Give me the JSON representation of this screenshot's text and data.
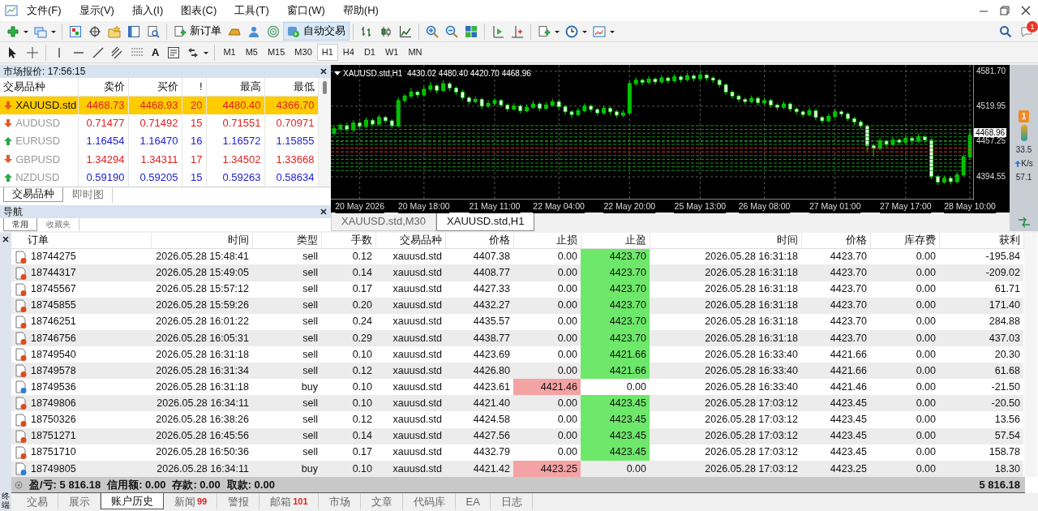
{
  "menu": [
    "文件(F)",
    "显示(V)",
    "插入(I)",
    "图表(C)",
    "工具(T)",
    "窗口(W)",
    "帮助(H)"
  ],
  "toolbar": {
    "new_order": "新订单",
    "auto_trading": "自动交易",
    "text_tool": "A",
    "notification_count": "1",
    "timeframes": [
      {
        "label": "M1",
        "selected": false
      },
      {
        "label": "M5",
        "selected": false
      },
      {
        "label": "M15",
        "selected": false
      },
      {
        "label": "M30",
        "selected": false
      },
      {
        "label": "H1",
        "selected": true
      },
      {
        "label": "H4",
        "selected": false
      },
      {
        "label": "D1",
        "selected": false
      },
      {
        "label": "W1",
        "selected": false
      },
      {
        "label": "MN",
        "selected": false
      }
    ]
  },
  "market_watch": {
    "title": "市场报价: 17:56:15",
    "columns": [
      "交易品种",
      "卖价",
      "买价",
      "!",
      "最高",
      "最低"
    ],
    "rows": [
      {
        "symbol": "XAUUSD.std",
        "bid": "4468.73",
        "ask": "4468.93",
        "spread": "20",
        "high": "4480.40",
        "low": "4366.70",
        "rising": false,
        "selected": true
      },
      {
        "symbol": "AUDUSD",
        "bid": "0.71477",
        "ask": "0.71492",
        "spread": "15",
        "high": "0.71551",
        "low": "0.70971",
        "rising": false,
        "selected": false
      },
      {
        "symbol": "EURUSD",
        "bid": "1.16454",
        "ask": "1.16470",
        "spread": "16",
        "high": "1.16572",
        "low": "1.15855",
        "rising": true,
        "selected": false
      },
      {
        "symbol": "GBPUSD",
        "bid": "1.34294",
        "ask": "1.34311",
        "spread": "17",
        "high": "1.34502",
        "low": "1.33668",
        "rising": false,
        "selected": false
      },
      {
        "symbol": "NZDUSD",
        "bid": "0.59190",
        "ask": "0.59205",
        "spread": "15",
        "high": "0.59263",
        "low": "0.58634",
        "rising": true,
        "selected": false
      }
    ],
    "tabs": [
      {
        "label": "交易品种",
        "selected": true
      },
      {
        "label": "即时图",
        "selected": false
      }
    ]
  },
  "navigator": {
    "title": "导航",
    "tabs": [
      {
        "label": "常用",
        "selected": true
      },
      {
        "label": "收藏夹",
        "selected": false
      }
    ]
  },
  "chart": {
    "title": "XAUUSD.std,H1  4430.02 4480.40 4420.70 4468.96",
    "current_price": "4468.96",
    "chart_data": {
      "type": "candlestick",
      "ylim": [
        4355.7,
        4593.2
      ],
      "grid": true,
      "categories": [
        null,
        null,
        null,
        null,
        "20 May 2026",
        null,
        null,
        null,
        null,
        null,
        null,
        null,
        null,
        null,
        "20 May 18:00",
        null,
        null,
        null,
        null,
        null,
        null,
        null,
        null,
        null,
        null,
        "21 May 11:00",
        null,
        null,
        null,
        null,
        null,
        null,
        null,
        null,
        null,
        "22 May 04:00",
        null,
        null,
        null,
        null,
        null,
        null,
        null,
        null,
        null,
        null,
        "22 May 20:00",
        null,
        null,
        null,
        null,
        null,
        null,
        null,
        null,
        null,
        null,
        "25 May 13:00",
        null,
        null,
        null,
        null,
        null,
        null,
        null,
        null,
        null,
        "26 May 08:00",
        null,
        null,
        null,
        null,
        null,
        null,
        null,
        null,
        null,
        null,
        "27 May 01:00",
        null,
        null,
        null,
        null,
        null,
        null,
        null,
        null,
        null,
        null,
        "27 May 17:00",
        null,
        null,
        null,
        null,
        null,
        null,
        null,
        null,
        null,
        "28 May 10:00"
      ],
      "yticks": [
        {
          "value": 4581.7,
          "label": "4581.70"
        },
        {
          "value": 4519.95,
          "label": "4519.95"
        },
        {
          "value": 4457.25,
          "label": "4457.25"
        },
        {
          "value": 4394.55,
          "label": "4394.55"
        }
      ],
      "ohlc": [
        [
          4472,
          4485,
          4468,
          4480
        ],
        [
          4480,
          4489,
          4476,
          4486
        ],
        [
          4486,
          4491,
          4475,
          4478
        ],
        [
          4478,
          4495,
          4474,
          4490
        ],
        [
          4490,
          4493,
          4480,
          4484
        ],
        [
          4484,
          4500,
          4481,
          4495
        ],
        [
          4495,
          4498,
          4484,
          4488
        ],
        [
          4488,
          4505,
          4485,
          4500
        ],
        [
          4500,
          4503,
          4490,
          4494
        ],
        [
          4494,
          4497,
          4481,
          4485
        ],
        [
          4485,
          4535,
          4482,
          4530
        ],
        [
          4530,
          4541,
          4526,
          4538
        ],
        [
          4538,
          4552,
          4534,
          4545
        ],
        [
          4545,
          4548,
          4535,
          4540
        ],
        [
          4540,
          4555,
          4537,
          4550
        ],
        [
          4550,
          4563,
          4546,
          4556
        ],
        [
          4556,
          4559,
          4543,
          4548
        ],
        [
          4548,
          4566,
          4545,
          4560
        ],
        [
          4560,
          4563,
          4547,
          4552
        ],
        [
          4552,
          4555,
          4540,
          4545
        ],
        [
          4545,
          4549,
          4530,
          4535
        ],
        [
          4535,
          4538,
          4523,
          4528
        ],
        [
          4528,
          4537,
          4525,
          4532
        ],
        [
          4532,
          4535,
          4515,
          4520
        ],
        [
          4520,
          4530,
          4517,
          4525
        ],
        [
          4525,
          4534,
          4521,
          4530
        ],
        [
          4530,
          4533,
          4518,
          4522
        ],
        [
          4522,
          4525,
          4510,
          4515
        ],
        [
          4515,
          4525,
          4512,
          4520
        ],
        [
          4520,
          4523,
          4507,
          4512
        ],
        [
          4512,
          4523,
          4509,
          4518
        ],
        [
          4518,
          4529,
          4515,
          4524
        ],
        [
          4524,
          4527,
          4511,
          4516
        ],
        [
          4516,
          4527,
          4513,
          4522
        ],
        [
          4522,
          4533,
          4519,
          4528
        ],
        [
          4528,
          4531,
          4514,
          4519
        ],
        [
          4519,
          4522,
          4505,
          4510
        ],
        [
          4510,
          4513,
          4499,
          4505
        ],
        [
          4505,
          4517,
          4502,
          4512
        ],
        [
          4512,
          4525,
          4509,
          4520
        ],
        [
          4520,
          4523,
          4509,
          4514
        ],
        [
          4514,
          4517,
          4503,
          4508
        ],
        [
          4508,
          4521,
          4505,
          4516
        ],
        [
          4516,
          4519,
          4505,
          4510
        ],
        [
          4510,
          4513,
          4499,
          4504
        ],
        [
          4504,
          4513,
          4500,
          4508
        ],
        [
          4508,
          4565,
          4505,
          4560
        ],
        [
          4560,
          4571,
          4556,
          4566
        ],
        [
          4566,
          4569,
          4557,
          4562
        ],
        [
          4562,
          4573,
          4559,
          4568
        ],
        [
          4568,
          4571,
          4558,
          4563
        ],
        [
          4563,
          4575,
          4560,
          4570
        ],
        [
          4570,
          4573,
          4560,
          4565
        ],
        [
          4565,
          4577,
          4562,
          4572
        ],
        [
          4572,
          4575,
          4562,
          4567
        ],
        [
          4567,
          4579,
          4564,
          4574
        ],
        [
          4574,
          4577,
          4564,
          4569
        ],
        [
          4569,
          4580,
          4566,
          4575
        ],
        [
          4575,
          4578,
          4565,
          4570
        ],
        [
          4570,
          4573,
          4561,
          4566
        ],
        [
          4566,
          4569,
          4553,
          4558
        ],
        [
          4558,
          4561,
          4540,
          4545
        ],
        [
          4545,
          4548,
          4533,
          4538
        ],
        [
          4538,
          4541,
          4527,
          4532
        ],
        [
          4532,
          4535,
          4523,
          4528
        ],
        [
          4528,
          4539,
          4525,
          4534
        ],
        [
          4534,
          4537,
          4521,
          4526
        ],
        [
          4526,
          4535,
          4523,
          4530
        ],
        [
          4530,
          4533,
          4517,
          4522
        ],
        [
          4522,
          4525,
          4513,
          4518
        ],
        [
          4518,
          4529,
          4515,
          4524
        ],
        [
          4524,
          4527,
          4510,
          4515
        ],
        [
          4515,
          4518,
          4505,
          4510
        ],
        [
          4510,
          4513,
          4500,
          4505
        ],
        [
          4505,
          4517,
          4502,
          4512
        ],
        [
          4512,
          4515,
          4495,
          4500
        ],
        [
          4500,
          4503,
          4489,
          4494
        ],
        [
          4494,
          4507,
          4491,
          4502
        ],
        [
          4502,
          4515,
          4499,
          4510
        ],
        [
          4510,
          4513,
          4501,
          4506
        ],
        [
          4506,
          4509,
          4493,
          4498
        ],
        [
          4498,
          4501,
          4487,
          4492
        ],
        [
          4492,
          4495,
          4480,
          4485
        ],
        [
          4485,
          4488,
          4440,
          4450
        ],
        [
          4450,
          4453,
          4430,
          4445
        ],
        [
          4445,
          4463,
          4442,
          4458
        ],
        [
          4458,
          4461,
          4447,
          4452
        ],
        [
          4452,
          4465,
          4449,
          4460
        ],
        [
          4460,
          4463,
          4451,
          4456
        ],
        [
          4456,
          4468,
          4453,
          4463
        ],
        [
          4463,
          4466,
          4453,
          4458
        ],
        [
          4458,
          4471,
          4455,
          4466
        ],
        [
          4466,
          4469,
          4455,
          4460
        ],
        [
          4460,
          4463,
          4390,
          4395
        ],
        [
          4395,
          4398,
          4380,
          4385
        ],
        [
          4385,
          4397,
          4382,
          4392
        ],
        [
          4392,
          4395,
          4381,
          4386
        ],
        [
          4386,
          4403,
          4383,
          4398
        ],
        [
          4398,
          4435,
          4395,
          4430
        ],
        [
          4430,
          4478,
          4427,
          4468
        ]
      ]
    },
    "tabs": [
      {
        "label": "XAUUSD.std,M30",
        "selected": false
      },
      {
        "label": "XAUUSD.std,H1",
        "selected": true
      }
    ]
  },
  "side_panel": {
    "alert_count": "1",
    "readings": [
      "33.5",
      "K/s",
      "57.1"
    ]
  },
  "terminal": {
    "side_label": "终端",
    "columns": [
      "订单",
      "时间",
      "类型",
      "手数",
      "交易品种",
      "价格",
      "止损",
      "止盈",
      "时间",
      "价格",
      "库存费",
      "获利"
    ],
    "rows": [
      {
        "order": "18744275",
        "open_time": "2026.05.28 15:48:41",
        "type": "sell",
        "lots": "0.12",
        "symbol": "xauusd.std",
        "open_price": "4407.38",
        "sl": "0.00",
        "tp": "4423.70",
        "close_time": "2026.05.28 16:31:18",
        "close_price": "4423.70",
        "swap": "0.00",
        "profit": "-195.84",
        "kind": "sell",
        "sl_hit": false,
        "tp_hit": true
      },
      {
        "order": "18744317",
        "open_time": "2026.05.28 15:49:05",
        "type": "sell",
        "lots": "0.14",
        "symbol": "xauusd.std",
        "open_price": "4408.77",
        "sl": "0.00",
        "tp": "4423.70",
        "close_time": "2026.05.28 16:31:18",
        "close_price": "4423.70",
        "swap": "0.00",
        "profit": "-209.02",
        "kind": "sell",
        "sl_hit": false,
        "tp_hit": true
      },
      {
        "order": "18745567",
        "open_time": "2026.05.28 15:57:12",
        "type": "sell",
        "lots": "0.17",
        "symbol": "xauusd.std",
        "open_price": "4427.33",
        "sl": "0.00",
        "tp": "4423.70",
        "close_time": "2026.05.28 16:31:18",
        "close_price": "4423.70",
        "swap": "0.00",
        "profit": "61.71",
        "kind": "sell",
        "sl_hit": false,
        "tp_hit": true
      },
      {
        "order": "18745855",
        "open_time": "2026.05.28 15:59:26",
        "type": "sell",
        "lots": "0.20",
        "symbol": "xauusd.std",
        "open_price": "4432.27",
        "sl": "0.00",
        "tp": "4423.70",
        "close_time": "2026.05.28 16:31:18",
        "close_price": "4423.70",
        "swap": "0.00",
        "profit": "171.40",
        "kind": "sell",
        "sl_hit": false,
        "tp_hit": true
      },
      {
        "order": "18746251",
        "open_time": "2026.05.28 16:01:22",
        "type": "sell",
        "lots": "0.24",
        "symbol": "xauusd.std",
        "open_price": "4435.57",
        "sl": "0.00",
        "tp": "4423.70",
        "close_time": "2026.05.28 16:31:18",
        "close_price": "4423.70",
        "swap": "0.00",
        "profit": "284.88",
        "kind": "sell",
        "sl_hit": false,
        "tp_hit": true
      },
      {
        "order": "18746756",
        "open_time": "2026.05.28 16:05:31",
        "type": "sell",
        "lots": "0.29",
        "symbol": "xauusd.std",
        "open_price": "4438.77",
        "sl": "0.00",
        "tp": "4423.70",
        "close_time": "2026.05.28 16:31:18",
        "close_price": "4423.70",
        "swap": "0.00",
        "profit": "437.03",
        "kind": "sell",
        "sl_hit": false,
        "tp_hit": true
      },
      {
        "order": "18749540",
        "open_time": "2026.05.28 16:31:18",
        "type": "sell",
        "lots": "0.10",
        "symbol": "xauusd.std",
        "open_price": "4423.69",
        "sl": "0.00",
        "tp": "4421.66",
        "close_time": "2026.05.28 16:33:40",
        "close_price": "4421.66",
        "swap": "0.00",
        "profit": "20.30",
        "kind": "sell",
        "sl_hit": false,
        "tp_hit": true
      },
      {
        "order": "18749578",
        "open_time": "2026.05.28 16:31:34",
        "type": "sell",
        "lots": "0.12",
        "symbol": "xauusd.std",
        "open_price": "4426.80",
        "sl": "0.00",
        "tp": "4421.66",
        "close_time": "2026.05.28 16:33:40",
        "close_price": "4421.66",
        "swap": "0.00",
        "profit": "61.68",
        "kind": "sell",
        "sl_hit": false,
        "tp_hit": true
      },
      {
        "order": "18749536",
        "open_time": "2026.05.28 16:31:18",
        "type": "buy",
        "lots": "0.10",
        "symbol": "xauusd.std",
        "open_price": "4423.61",
        "sl": "4421.46",
        "tp": "0.00",
        "close_time": "2026.05.28 16:33:40",
        "close_price": "4421.46",
        "swap": "0.00",
        "profit": "-21.50",
        "kind": "buy",
        "sl_hit": true,
        "tp_hit": false
      },
      {
        "order": "18749806",
        "open_time": "2026.05.28 16:34:11",
        "type": "sell",
        "lots": "0.10",
        "symbol": "xauusd.std",
        "open_price": "4421.40",
        "sl": "0.00",
        "tp": "4423.45",
        "close_time": "2026.05.28 17:03:12",
        "close_price": "4423.45",
        "swap": "0.00",
        "profit": "-20.50",
        "kind": "sell",
        "sl_hit": false,
        "tp_hit": true
      },
      {
        "order": "18750326",
        "open_time": "2026.05.28 16:38:26",
        "type": "sell",
        "lots": "0.12",
        "symbol": "xauusd.std",
        "open_price": "4424.58",
        "sl": "0.00",
        "tp": "4423.45",
        "close_time": "2026.05.28 17:03:12",
        "close_price": "4423.45",
        "swap": "0.00",
        "profit": "13.56",
        "kind": "sell",
        "sl_hit": false,
        "tp_hit": true
      },
      {
        "order": "18751271",
        "open_time": "2026.05.28 16:45:56",
        "type": "sell",
        "lots": "0.14",
        "symbol": "xauusd.std",
        "open_price": "4427.56",
        "sl": "0.00",
        "tp": "4423.45",
        "close_time": "2026.05.28 17:03:12",
        "close_price": "4423.45",
        "swap": "0.00",
        "profit": "57.54",
        "kind": "sell",
        "sl_hit": false,
        "tp_hit": true
      },
      {
        "order": "18751710",
        "open_time": "2026.05.28 16:50:36",
        "type": "sell",
        "lots": "0.17",
        "symbol": "xauusd.std",
        "open_price": "4432.79",
        "sl": "0.00",
        "tp": "4423.45",
        "close_time": "2026.05.28 17:03:12",
        "close_price": "4423.45",
        "swap": "0.00",
        "profit": "158.78",
        "kind": "sell",
        "sl_hit": false,
        "tp_hit": true
      },
      {
        "order": "18749805",
        "open_time": "2026.05.28 16:34:11",
        "type": "buy",
        "lots": "0.10",
        "symbol": "xauusd.std",
        "open_price": "4421.42",
        "sl": "4423.25",
        "tp": "0.00",
        "close_time": "2026.05.28 17:03:12",
        "close_price": "4423.25",
        "swap": "0.00",
        "profit": "18.30",
        "kind": "buy",
        "sl_hit": true,
        "tp_hit": false
      }
    ],
    "summary": [
      "盈/亏: 5 816.18",
      "信用额: 0.00",
      "存款: 0.00",
      "取款: 0.00"
    ],
    "total": "5 816.18",
    "tabs": [
      {
        "label": "交易",
        "selected": false
      },
      {
        "label": "展示",
        "selected": false
      },
      {
        "label": "账户历史",
        "selected": true
      },
      {
        "label": "新闻",
        "badge": "99",
        "selected": false
      },
      {
        "label": "警报",
        "selected": false
      },
      {
        "label": "邮箱",
        "badge": "101",
        "selected": false
      },
      {
        "label": "市场",
        "selected": false
      },
      {
        "label": "文章",
        "selected": false
      },
      {
        "label": "代码库",
        "selected": false
      },
      {
        "label": "EA",
        "selected": false
      },
      {
        "label": "日志",
        "selected": false
      }
    ]
  }
}
